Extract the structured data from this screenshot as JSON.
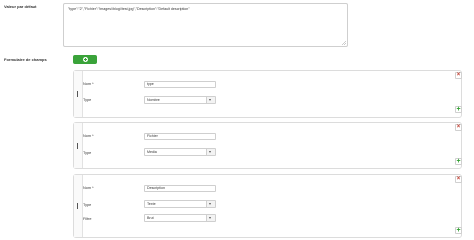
{
  "default_value": {
    "label": "Valeur par défaut",
    "content": "\"type\":\"2\",\"Fichier\":\"images\\/blog\\/test.jpg\",\"Description\":\"Default description\""
  },
  "fields_form": {
    "label": "Formulaire de champs",
    "add_icon": "plus-circle-icon",
    "rows": [
      {
        "name_label": "Nom *",
        "name_value": "type",
        "type_label": "Type",
        "type_value": "Nombre"
      },
      {
        "name_label": "Nom *",
        "name_value": "Fichier",
        "type_label": "Type",
        "type_value": "Media"
      },
      {
        "name_label": "Nom *",
        "name_value": "Description",
        "type_label": "Type",
        "type_value": "Texte",
        "filter_label": "Filtre",
        "filter_value": "Brut"
      }
    ]
  },
  "colors": {
    "accent_green": "#3aa33a",
    "delete_red": "#c0392b"
  },
  "icons": {
    "drag": "drag-handle-icon",
    "delete": "close-icon",
    "add_row": "plus-icon"
  }
}
